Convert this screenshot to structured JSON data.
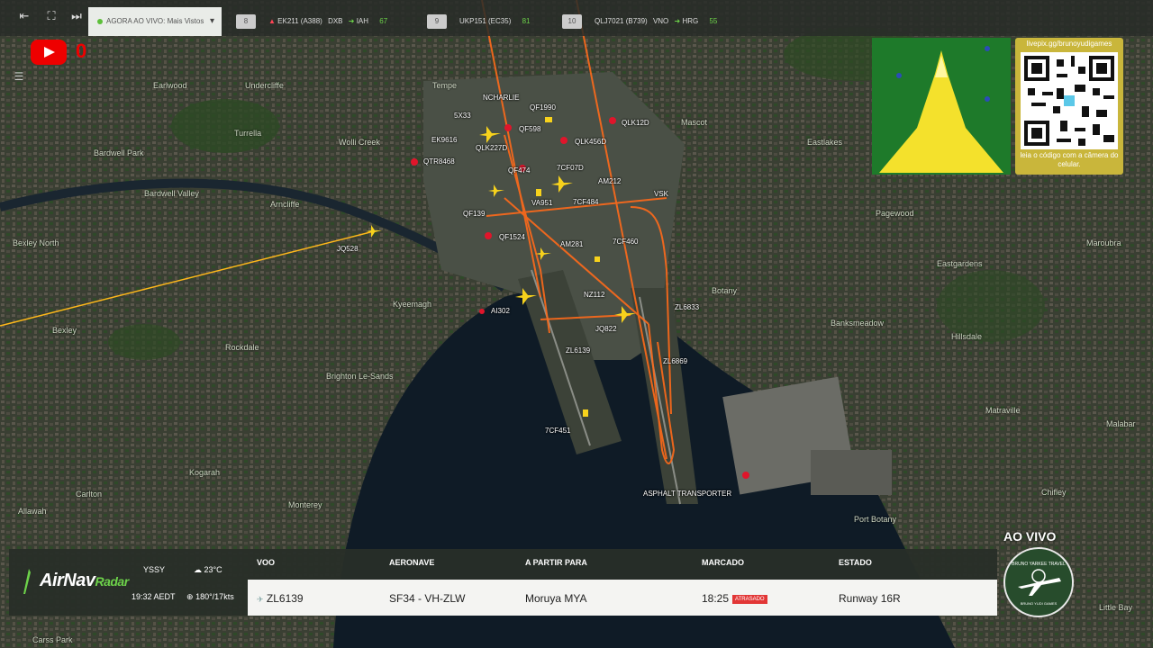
{
  "topbar": {
    "live_label": "AGORA AO VIVO:",
    "live_value": "Mais Vistos",
    "tickets": [
      {
        "num": "8",
        "flight": "EK211 (A388)",
        "from": "DXB",
        "to": "IAH",
        "eta": "67"
      },
      {
        "num": "9",
        "flight": "UKP151 (EC35)",
        "eta": "81"
      },
      {
        "num": "10",
        "flight": "QLJ7021 (B739)",
        "from": "VNO",
        "to": "HRG",
        "eta": "55"
      }
    ]
  },
  "youtube": {
    "count": "0"
  },
  "suburbs": [
    "Earlwood",
    "Undercliffe",
    "Turrella",
    "Bardwell Park",
    "Bardwell Valley",
    "Arncliffe",
    "Bexley North",
    "Bexley",
    "Rockdale",
    "Kogarah",
    "Carlton",
    "Allawah",
    "Monterey",
    "Brighton Le-Sands",
    "Kyeemagh",
    "Tempe",
    "Wolli Creek",
    "Mascot",
    "Eastlakes",
    "Pagewood",
    "Eastgardens",
    "Maroubra",
    "Botany",
    "Banksmeadow",
    "Hillsdale",
    "Matraville",
    "Chifley",
    "Port Botany",
    "Malabar",
    "Little Bay",
    "Carss Park"
  ],
  "aircraft_labels": [
    "NCHARLIE",
    "QF1990",
    "5X33",
    "QF598",
    "QLK12D",
    "EK9616",
    "QLK456D",
    "QLK227D",
    "QTR8468",
    "QF474",
    "7CF07D",
    "AM212",
    "VSK",
    "VA951",
    "7CF484",
    "QF139",
    "QF1524",
    "AM281",
    "7CF460",
    "JQ528",
    "NZ112",
    "AI302",
    "ZL6833",
    "JQ822",
    "ZL6139",
    "ZL6869",
    "7CF451",
    "ASPHALT TRANSPORTER"
  ],
  "branding": {
    "qr_url": "livepix.gg/brunoyudigames",
    "qr_caption": "leia o código com a câmera do celular.",
    "live": "AO VIVO",
    "badge_title": "BRUNO YARKEE TRAVEL",
    "badge_sub": "BRUNO YUDI GAMES"
  },
  "panel": {
    "logo_main": "AirNav",
    "logo_sub": "Radar",
    "airport": "YSSY",
    "local_time": "19:32 AEDT",
    "temperature": "23°C",
    "wind": "180°/17kts",
    "headers": {
      "flight": "VOO",
      "aircraft": "AERONAVE",
      "departing": "A PARTIR PARA",
      "scheduled": "MARCADO",
      "status": "ESTADO"
    },
    "row": {
      "flight": "ZL6139",
      "aircraft": "SF34 - VH-ZLW",
      "destination": "Moruya MYA",
      "time": "18:25",
      "delay": "ATRASADO",
      "status": "Runway 16R"
    }
  },
  "colors": {
    "accent_green": "#6dd24a",
    "track_orange": "#ff6a1a",
    "approach_yellow": "#ffc21a",
    "airline_red": "#e0152b"
  }
}
